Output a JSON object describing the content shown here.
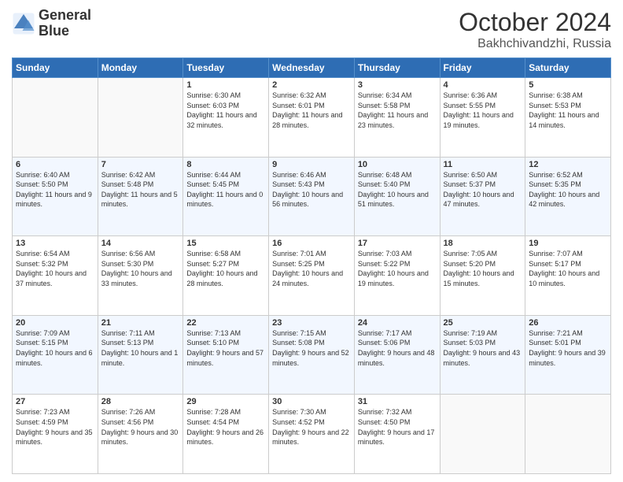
{
  "logo": {
    "line1": "General",
    "line2": "Blue"
  },
  "title": "October 2024",
  "location": "Bakhchivandzhi, Russia",
  "weekdays": [
    "Sunday",
    "Monday",
    "Tuesday",
    "Wednesday",
    "Thursday",
    "Friday",
    "Saturday"
  ],
  "weeks": [
    [
      {
        "day": "",
        "sunrise": "",
        "sunset": "",
        "daylight": ""
      },
      {
        "day": "",
        "sunrise": "",
        "sunset": "",
        "daylight": ""
      },
      {
        "day": "1",
        "sunrise": "Sunrise: 6:30 AM",
        "sunset": "Sunset: 6:03 PM",
        "daylight": "Daylight: 11 hours and 32 minutes."
      },
      {
        "day": "2",
        "sunrise": "Sunrise: 6:32 AM",
        "sunset": "Sunset: 6:01 PM",
        "daylight": "Daylight: 11 hours and 28 minutes."
      },
      {
        "day": "3",
        "sunrise": "Sunrise: 6:34 AM",
        "sunset": "Sunset: 5:58 PM",
        "daylight": "Daylight: 11 hours and 23 minutes."
      },
      {
        "day": "4",
        "sunrise": "Sunrise: 6:36 AM",
        "sunset": "Sunset: 5:55 PM",
        "daylight": "Daylight: 11 hours and 19 minutes."
      },
      {
        "day": "5",
        "sunrise": "Sunrise: 6:38 AM",
        "sunset": "Sunset: 5:53 PM",
        "daylight": "Daylight: 11 hours and 14 minutes."
      }
    ],
    [
      {
        "day": "6",
        "sunrise": "Sunrise: 6:40 AM",
        "sunset": "Sunset: 5:50 PM",
        "daylight": "Daylight: 11 hours and 9 minutes."
      },
      {
        "day": "7",
        "sunrise": "Sunrise: 6:42 AM",
        "sunset": "Sunset: 5:48 PM",
        "daylight": "Daylight: 11 hours and 5 minutes."
      },
      {
        "day": "8",
        "sunrise": "Sunrise: 6:44 AM",
        "sunset": "Sunset: 5:45 PM",
        "daylight": "Daylight: 11 hours and 0 minutes."
      },
      {
        "day": "9",
        "sunrise": "Sunrise: 6:46 AM",
        "sunset": "Sunset: 5:43 PM",
        "daylight": "Daylight: 10 hours and 56 minutes."
      },
      {
        "day": "10",
        "sunrise": "Sunrise: 6:48 AM",
        "sunset": "Sunset: 5:40 PM",
        "daylight": "Daylight: 10 hours and 51 minutes."
      },
      {
        "day": "11",
        "sunrise": "Sunrise: 6:50 AM",
        "sunset": "Sunset: 5:37 PM",
        "daylight": "Daylight: 10 hours and 47 minutes."
      },
      {
        "day": "12",
        "sunrise": "Sunrise: 6:52 AM",
        "sunset": "Sunset: 5:35 PM",
        "daylight": "Daylight: 10 hours and 42 minutes."
      }
    ],
    [
      {
        "day": "13",
        "sunrise": "Sunrise: 6:54 AM",
        "sunset": "Sunset: 5:32 PM",
        "daylight": "Daylight: 10 hours and 37 minutes."
      },
      {
        "day": "14",
        "sunrise": "Sunrise: 6:56 AM",
        "sunset": "Sunset: 5:30 PM",
        "daylight": "Daylight: 10 hours and 33 minutes."
      },
      {
        "day": "15",
        "sunrise": "Sunrise: 6:58 AM",
        "sunset": "Sunset: 5:27 PM",
        "daylight": "Daylight: 10 hours and 28 minutes."
      },
      {
        "day": "16",
        "sunrise": "Sunrise: 7:01 AM",
        "sunset": "Sunset: 5:25 PM",
        "daylight": "Daylight: 10 hours and 24 minutes."
      },
      {
        "day": "17",
        "sunrise": "Sunrise: 7:03 AM",
        "sunset": "Sunset: 5:22 PM",
        "daylight": "Daylight: 10 hours and 19 minutes."
      },
      {
        "day": "18",
        "sunrise": "Sunrise: 7:05 AM",
        "sunset": "Sunset: 5:20 PM",
        "daylight": "Daylight: 10 hours and 15 minutes."
      },
      {
        "day": "19",
        "sunrise": "Sunrise: 7:07 AM",
        "sunset": "Sunset: 5:17 PM",
        "daylight": "Daylight: 10 hours and 10 minutes."
      }
    ],
    [
      {
        "day": "20",
        "sunrise": "Sunrise: 7:09 AM",
        "sunset": "Sunset: 5:15 PM",
        "daylight": "Daylight: 10 hours and 6 minutes."
      },
      {
        "day": "21",
        "sunrise": "Sunrise: 7:11 AM",
        "sunset": "Sunset: 5:13 PM",
        "daylight": "Daylight: 10 hours and 1 minute."
      },
      {
        "day": "22",
        "sunrise": "Sunrise: 7:13 AM",
        "sunset": "Sunset: 5:10 PM",
        "daylight": "Daylight: 9 hours and 57 minutes."
      },
      {
        "day": "23",
        "sunrise": "Sunrise: 7:15 AM",
        "sunset": "Sunset: 5:08 PM",
        "daylight": "Daylight: 9 hours and 52 minutes."
      },
      {
        "day": "24",
        "sunrise": "Sunrise: 7:17 AM",
        "sunset": "Sunset: 5:06 PM",
        "daylight": "Daylight: 9 hours and 48 minutes."
      },
      {
        "day": "25",
        "sunrise": "Sunrise: 7:19 AM",
        "sunset": "Sunset: 5:03 PM",
        "daylight": "Daylight: 9 hours and 43 minutes."
      },
      {
        "day": "26",
        "sunrise": "Sunrise: 7:21 AM",
        "sunset": "Sunset: 5:01 PM",
        "daylight": "Daylight: 9 hours and 39 minutes."
      }
    ],
    [
      {
        "day": "27",
        "sunrise": "Sunrise: 7:23 AM",
        "sunset": "Sunset: 4:59 PM",
        "daylight": "Daylight: 9 hours and 35 minutes."
      },
      {
        "day": "28",
        "sunrise": "Sunrise: 7:26 AM",
        "sunset": "Sunset: 4:56 PM",
        "daylight": "Daylight: 9 hours and 30 minutes."
      },
      {
        "day": "29",
        "sunrise": "Sunrise: 7:28 AM",
        "sunset": "Sunset: 4:54 PM",
        "daylight": "Daylight: 9 hours and 26 minutes."
      },
      {
        "day": "30",
        "sunrise": "Sunrise: 7:30 AM",
        "sunset": "Sunset: 4:52 PM",
        "daylight": "Daylight: 9 hours and 22 minutes."
      },
      {
        "day": "31",
        "sunrise": "Sunrise: 7:32 AM",
        "sunset": "Sunset: 4:50 PM",
        "daylight": "Daylight: 9 hours and 17 minutes."
      },
      {
        "day": "",
        "sunrise": "",
        "sunset": "",
        "daylight": ""
      },
      {
        "day": "",
        "sunrise": "",
        "sunset": "",
        "daylight": ""
      }
    ]
  ]
}
